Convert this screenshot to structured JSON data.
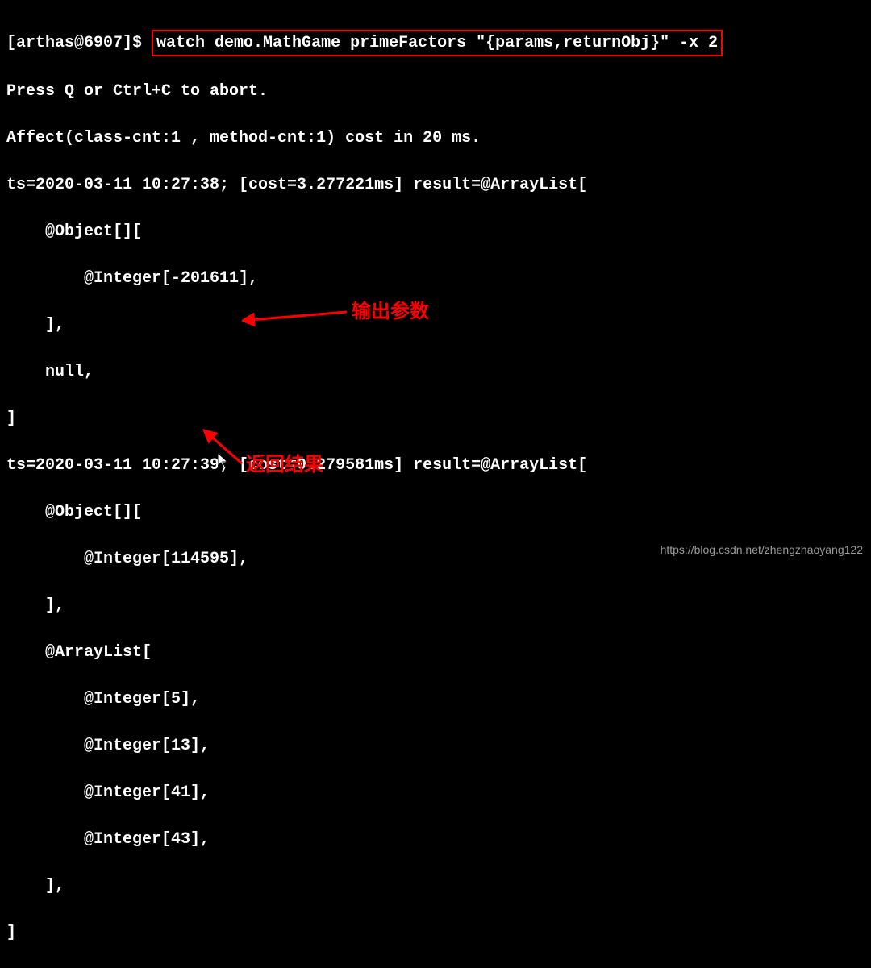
{
  "prompt": "[arthas@6907]$ ",
  "command": "watch demo.MathGame primeFactors \"{params,returnObj}\" -x 2",
  "lines": {
    "l1": "Press Q or Ctrl+C to abort.",
    "l2": "Affect(class-cnt:1 , method-cnt:1) cost in 20 ms.",
    "l3": "ts=2020-03-11 10:27:38; [cost=3.277221ms] result=@ArrayList[",
    "l4": "    @Object[][",
    "l5": "        @Integer[-201611],",
    "l6": "    ],",
    "l7": "    null,",
    "l8": "]",
    "l9": "ts=2020-03-11 10:27:39; [cost=0.279581ms] result=@ArrayList[",
    "l10": "    @Object[][",
    "l11": "        @Integer[114595],",
    "l12": "    ],",
    "l13": "    @ArrayList[",
    "l14": "        @Integer[5],",
    "l15": "        @Integer[13],",
    "l16": "        @Integer[41],",
    "l17": "        @Integer[43],",
    "l18": "    ],",
    "l19": "]"
  },
  "annotations": {
    "a1": "输出参数",
    "a2": "返回结果"
  },
  "watermark": "https://blog.csdn.net/zhengzhaoyang122"
}
